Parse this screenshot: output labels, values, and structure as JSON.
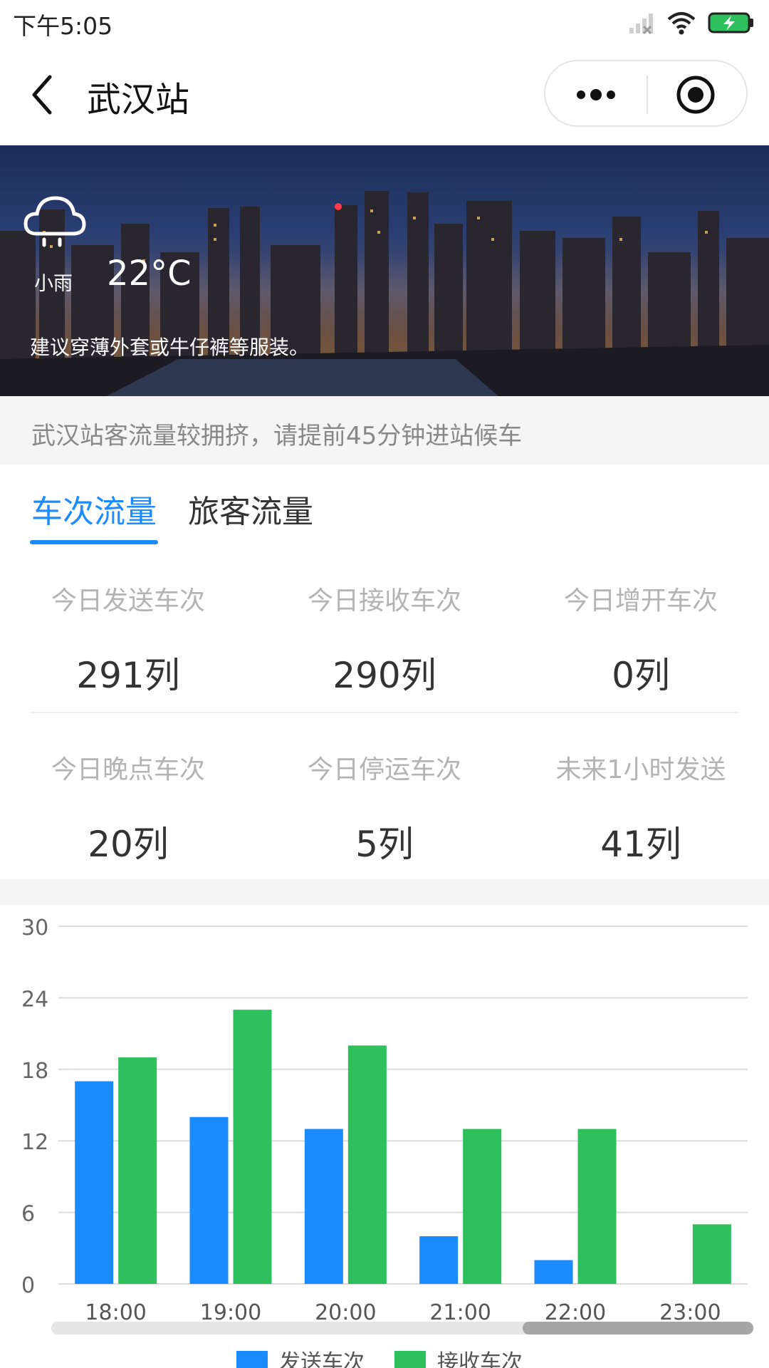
{
  "status_bar": {
    "time": "下午5:05",
    "icons": [
      "signal-icon",
      "wifi-icon",
      "battery-charging-icon"
    ]
  },
  "nav": {
    "title": "武汉站",
    "back_icon": "chevron-left-icon",
    "more_icon": "more-dots-icon",
    "target_icon": "target-icon"
  },
  "weather": {
    "icon": "cloud-rain-icon",
    "condition": "小雨",
    "temperature": "22°C",
    "tip": "建议穿薄外套或牛仔裤等服装。"
  },
  "notice": "武汉站客流量较拥挤，请提前45分钟进站候车",
  "tabs": [
    {
      "label": "车次流量",
      "active": true
    },
    {
      "label": "旅客流量",
      "active": false
    }
  ],
  "stats": [
    {
      "label": "今日发送车次",
      "value": "291列"
    },
    {
      "label": "今日接收车次",
      "value": "290列"
    },
    {
      "label": "今日增开车次",
      "value": "0列"
    },
    {
      "label": "今日晚点车次",
      "value": "20列"
    },
    {
      "label": "今日停运车次",
      "value": "5列"
    },
    {
      "label": "未来1小时发送",
      "value": "41列"
    }
  ],
  "chart_data": {
    "type": "bar",
    "categories": [
      "18:00",
      "19:00",
      "20:00",
      "21:00",
      "22:00",
      "23:00"
    ],
    "series": [
      {
        "name": "发送车次",
        "values": [
          17,
          14,
          13,
          4,
          2,
          0
        ],
        "color": "#1a8cff"
      },
      {
        "name": "接收车次",
        "values": [
          19,
          23,
          20,
          13,
          13,
          5
        ],
        "color": "#2dc05c"
      }
    ],
    "ylim": [
      0,
      30
    ],
    "yticks": [
      "0",
      "6",
      "12",
      "18",
      "24",
      "30"
    ],
    "grid": true,
    "legend_position": "bottom"
  },
  "colors": {
    "accent": "#1a8cff",
    "send": "#1a8cff",
    "receive": "#2dc05c"
  }
}
